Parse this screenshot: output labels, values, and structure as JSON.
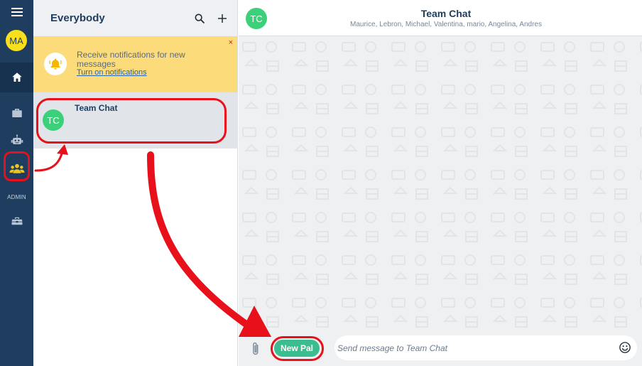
{
  "nav": {
    "avatar_initials": "MA",
    "admin_label": "ADMIN",
    "icons": [
      "menu-icon",
      "home-icon",
      "briefcase-icon",
      "robot-icon",
      "people-icon",
      "toolbox-icon"
    ]
  },
  "list": {
    "title": "Everybody",
    "notification": {
      "text": "Receive notifications for new messages",
      "link": "Turn on notifications",
      "close": "×"
    },
    "items": [
      {
        "initials": "TC",
        "name": "Team Chat"
      }
    ]
  },
  "chat": {
    "initials": "TC",
    "title": "Team Chat",
    "members": "Maurice, Lebron, Michael, Valentina, mario, Angelina, Andres"
  },
  "composer": {
    "button_label": "New Pal",
    "placeholder": "Send message to Team Chat"
  },
  "colors": {
    "rail": "#1f3d5f",
    "avatar": "#f8e01c",
    "chat_avatar": "#3cd07a",
    "notification_bg": "#fcdc7a",
    "button": "#3bbd8f",
    "annotation": "#e8101a"
  }
}
